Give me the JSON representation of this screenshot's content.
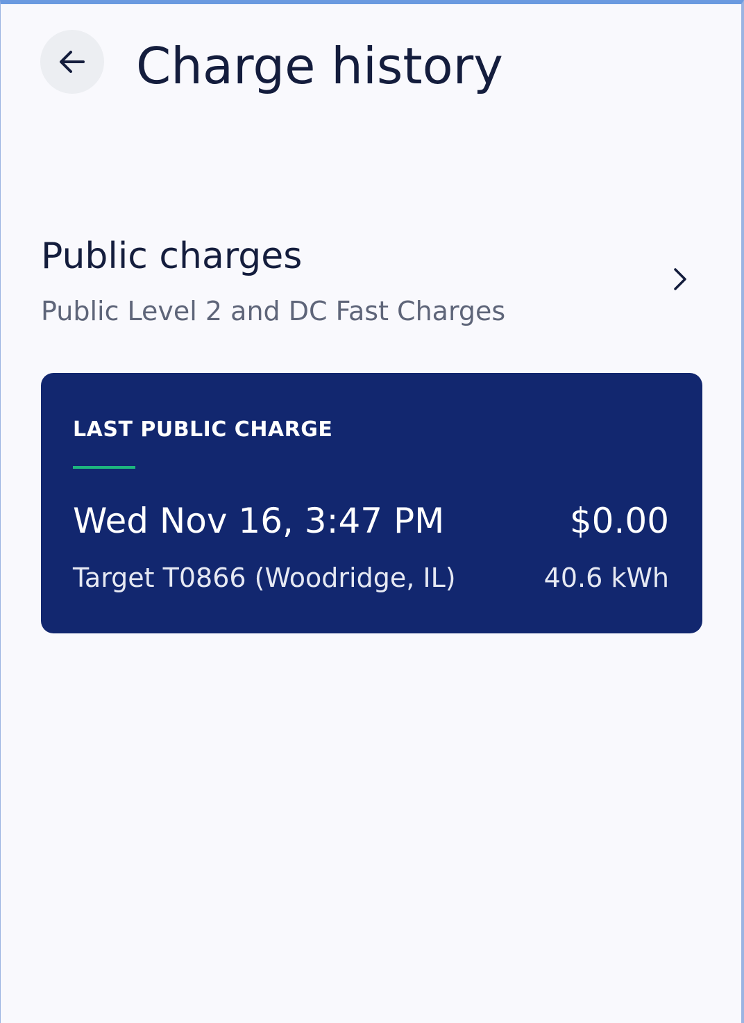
{
  "header": {
    "title": "Charge history",
    "back_icon": "arrow-left-icon"
  },
  "public_charges": {
    "title": "Public charges",
    "subtitle": "Public Level 2 and DC Fast Charges",
    "chevron_icon": "chevron-right-icon"
  },
  "last_charge": {
    "label": "LAST PUBLIC CHARGE",
    "date": "Wed Nov 16, 3:47 PM",
    "amount": "$0.00",
    "location": "Target T0866 (Woodridge, IL)",
    "energy": "40.6 kWh"
  },
  "colors": {
    "background": "#f9f9fd",
    "text_primary": "#141d3d",
    "text_secondary": "#5e6579",
    "card_background": "#12276f",
    "card_accent": "#1db67e",
    "back_button_background": "#eceef2"
  }
}
